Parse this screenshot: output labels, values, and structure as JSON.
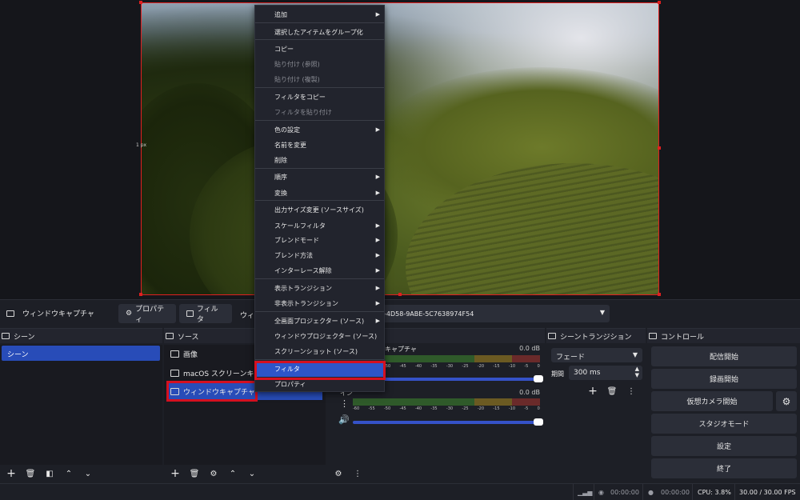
{
  "preview": {
    "size_label": "1 px"
  },
  "source_toolbar": {
    "source_name": "ウィンドウキャプチャ",
    "properties_label": "プロパティ",
    "filters_label": "フィルタ",
    "window_label": "ウィン",
    "window_value": "-4D58-9ABE-5C7638974F54"
  },
  "context_menu": {
    "items": [
      {
        "label": "追加",
        "submenu": true,
        "disabled": false
      },
      {
        "label": "選択したアイテムをグループ化",
        "submenu": false,
        "disabled": false
      },
      {
        "label": "コピー",
        "submenu": false,
        "disabled": false
      },
      {
        "label": "貼り付け (参照)",
        "submenu": false,
        "disabled": true
      },
      {
        "label": "貼り付け (複製)",
        "submenu": false,
        "disabled": true
      },
      {
        "label": "フィルタをコピー",
        "submenu": false,
        "disabled": false
      },
      {
        "label": "フィルタを貼り付け",
        "submenu": false,
        "disabled": true
      },
      {
        "label": "色の設定",
        "submenu": true,
        "disabled": false
      },
      {
        "label": "名前を変更",
        "submenu": false,
        "disabled": false
      },
      {
        "label": "削除",
        "submenu": false,
        "disabled": false
      },
      {
        "label": "順序",
        "submenu": true,
        "disabled": false
      },
      {
        "label": "変換",
        "submenu": true,
        "disabled": false
      },
      {
        "label": "出力サイズ変更 (ソースサイズ)",
        "submenu": false,
        "disabled": false
      },
      {
        "label": "スケールフィルタ",
        "submenu": true,
        "disabled": false
      },
      {
        "label": "ブレンドモード",
        "submenu": true,
        "disabled": false
      },
      {
        "label": "ブレンド方法",
        "submenu": true,
        "disabled": false
      },
      {
        "label": "インターレース解除",
        "submenu": true,
        "disabled": false
      },
      {
        "label": "表示トランジション",
        "submenu": true,
        "disabled": false
      },
      {
        "label": "非表示トランジション",
        "submenu": true,
        "disabled": false
      },
      {
        "label": "全画面プロジェクター (ソース)",
        "submenu": true,
        "disabled": false
      },
      {
        "label": "ウィンドウプロジェクター (ソース)",
        "submenu": false,
        "disabled": false
      },
      {
        "label": "スクリーンショット (ソース)",
        "submenu": false,
        "disabled": false
      },
      {
        "label": "フィルタ",
        "submenu": false,
        "disabled": false,
        "highlighted": true
      },
      {
        "label": "プロパティ",
        "submenu": false,
        "disabled": false
      }
    ]
  },
  "scenes": {
    "title": "シーン",
    "items": [
      "シーン"
    ]
  },
  "sources": {
    "title": "ソース",
    "items": [
      "画像",
      "macOS スクリーンキャプチャ",
      "ウィンドウキャプチャ"
    ]
  },
  "mixer": {
    "channel1_label": "キャプチャ",
    "channel1_db": "0.0 dB",
    "channel2_label": "イン",
    "channel2_db": "0.0 dB",
    "ticks": [
      "-60",
      "-55",
      "-50",
      "-45",
      "-40",
      "-35",
      "-30",
      "-25",
      "-20",
      "-15",
      "-10",
      "-5",
      "0"
    ],
    "volume1": 1.0,
    "volume2": 1.0
  },
  "transition": {
    "title": "シーントランジション",
    "type": "フェード",
    "duration_label": "期間",
    "duration_value": "300 ms"
  },
  "controls": {
    "title": "コントロール",
    "start_stream": "配信開始",
    "start_record": "録画開始",
    "start_vcam": "仮想カメラ開始",
    "studio_mode": "スタジオモード",
    "settings": "設定",
    "exit": "終了"
  },
  "status": {
    "stream_time": "00:00:00",
    "record_time": "00:00:00",
    "cpu": "CPU: 3.8%",
    "fps": "30.00 / 30.00 FPS"
  }
}
